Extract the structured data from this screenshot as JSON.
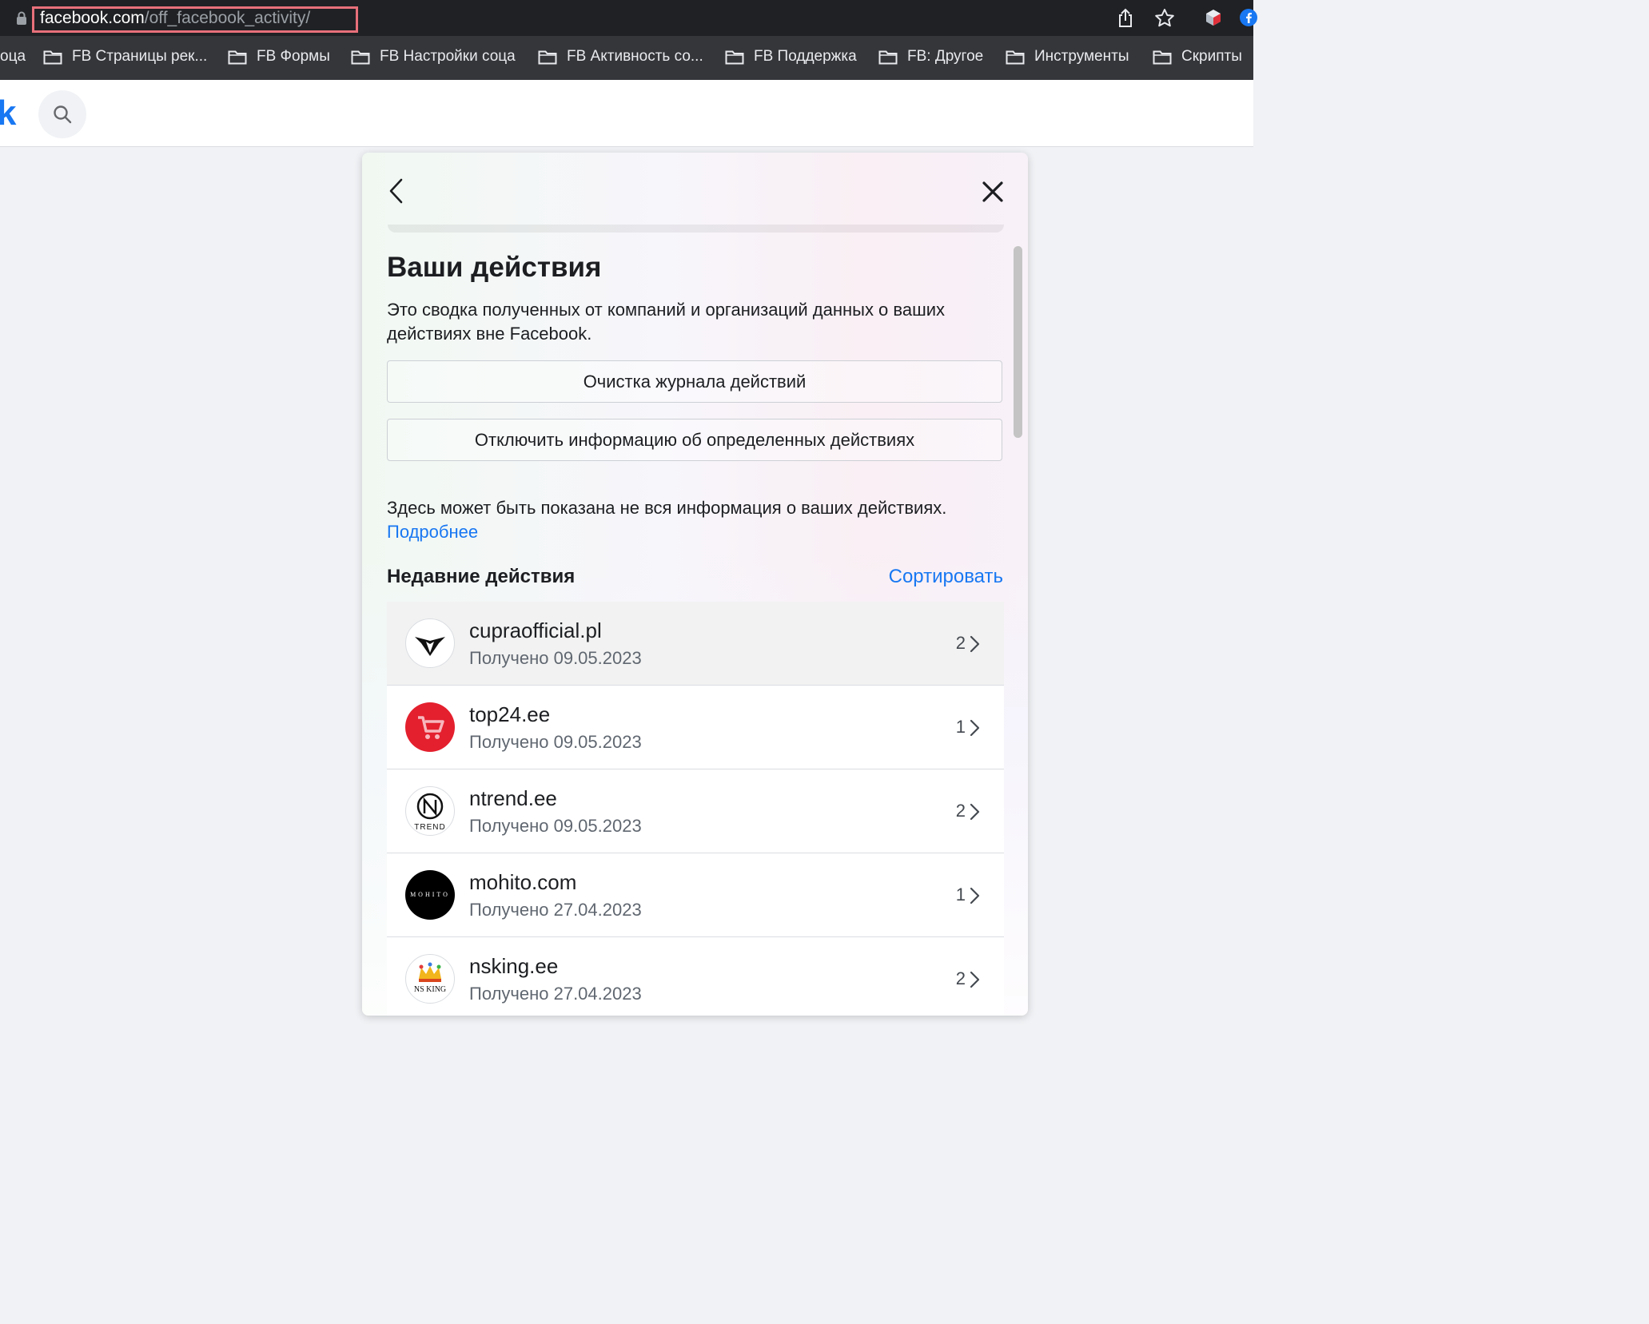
{
  "browser": {
    "url_host": "facebook.com",
    "url_path": "/off_facebook_activity/",
    "bookmarks": {
      "first_fragment": "оца",
      "items": [
        "FB Страницы рек...",
        "FB Формы",
        "FB Настройки соца",
        "FB Активность со...",
        "FB Поддержка",
        "FB: Другое",
        "Инструменты",
        "Скрипты"
      ]
    }
  },
  "fb_header": {
    "logo_fragment": "k"
  },
  "dialog": {
    "title": "Ваши действия",
    "description": "Это сводка полученных от компаний и организаций данных о ваших действиях вне Facebook.",
    "clear_history_label": "Очистка журнала действий",
    "disconnect_label": "Отключить информацию об определенных действиях",
    "note_text": "Здесь может быть показана не вся информация о ваших действиях.",
    "learn_more_label": "Подробнее",
    "recent_title": "Недавние действия",
    "sort_label": "Сортировать",
    "activities": [
      {
        "name": "cupraofficial.pl",
        "date": "Получено 09.05.2023",
        "count": "2",
        "icon": "cupra-logo-icon"
      },
      {
        "name": "top24.ee",
        "date": "Получено 09.05.2023",
        "count": "1",
        "icon": "shopping-cart-icon"
      },
      {
        "name": "ntrend.ee",
        "date": "Получено 09.05.2023",
        "count": "2",
        "icon": "ntrend-logo-icon",
        "logo_text": "TREND"
      },
      {
        "name": "mohito.com",
        "date": "Получено 27.04.2023",
        "count": "1",
        "icon": "mohito-logo-icon",
        "logo_text": "MOHITO"
      },
      {
        "name": "nsking.ee",
        "date": "Получено 27.04.2023",
        "count": "2",
        "icon": "crown-icon",
        "logo_text": "NS KING"
      }
    ]
  },
  "colors": {
    "accent": "#1877f2",
    "url_highlight": "#e8707a",
    "chrome_bg": "#202124",
    "bookmarks_bg": "#35363a"
  }
}
